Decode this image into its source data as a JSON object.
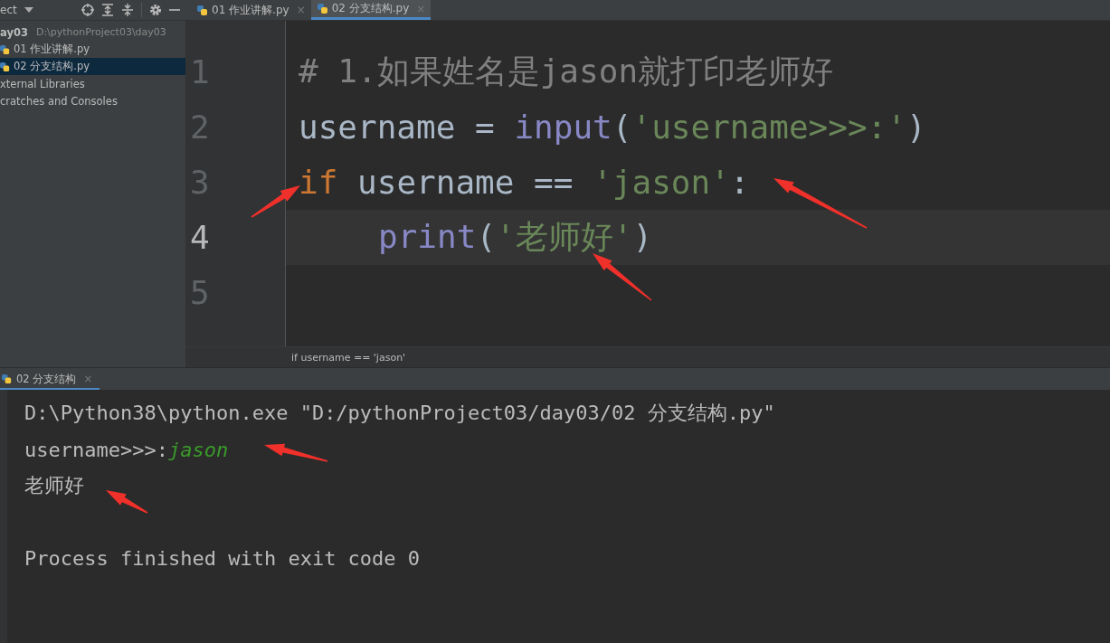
{
  "project_panel": {
    "title": "ect",
    "tree": [
      {
        "name": "ay03",
        "path": "D:\\pythonProject03\\day03",
        "children": [
          {
            "name": "01 作业讲解.py",
            "kind": "python",
            "selected": false
          },
          {
            "name": "02 分支结构.py",
            "kind": "python",
            "selected": true
          }
        ]
      },
      {
        "name": "xternal Libraries",
        "selected": false
      },
      {
        "name": "cratches and Consoles",
        "selected": false
      }
    ]
  },
  "tabs": [
    {
      "label": "01 作业讲解.py",
      "selected": false,
      "close": "×"
    },
    {
      "label": "02 分支结构.py",
      "selected": true,
      "close": "×"
    }
  ],
  "editor": {
    "lines": [
      {
        "number": "1",
        "current": false,
        "kind": "top",
        "tokens": [
          {
            "kind": "comment",
            "text": "# 1.如果姓名是jason就打印老师好"
          }
        ]
      },
      {
        "number": "2",
        "current": false,
        "kind": "top",
        "tokens": [
          {
            "kind": "ident",
            "text": "username = "
          },
          {
            "kind": "builtin",
            "text": "input"
          },
          {
            "kind": "ident",
            "text": "("
          },
          {
            "kind": "string",
            "text": "'username>>>:'"
          },
          {
            "kind": "ident",
            "text": ")"
          }
        ]
      },
      {
        "number": "3",
        "current": false,
        "kind": "top",
        "tokens": [
          {
            "kind": "keyword",
            "text": "if "
          },
          {
            "kind": "ident",
            "text": "username == "
          },
          {
            "kind": "string",
            "text": "'jason'"
          },
          {
            "kind": "ident",
            "text": ":"
          }
        ]
      },
      {
        "number": "4",
        "current": true,
        "kind": "body",
        "tokens": [
          {
            "kind": "builtin",
            "text": "print"
          },
          {
            "kind": "ident",
            "text": "("
          },
          {
            "kind": "string",
            "text": "'老师好'"
          },
          {
            "kind": "ident",
            "text": ")"
          }
        ]
      },
      {
        "number": "5",
        "current": false
      }
    ],
    "breadcrumb": "if username == 'jason'"
  },
  "run_panel": {
    "tab": {
      "label": "02 分支结构",
      "close": "×"
    },
    "lines": [
      {
        "tokens": [
          {
            "kind": "plain",
            "text": "D:\\Python38\\python.exe \"D:/pythonProject03/day03/02 分支结构.py\""
          }
        ]
      },
      {
        "tokens": [
          {
            "kind": "plain",
            "text": "username>>>:"
          },
          {
            "kind": "input",
            "text": "jason"
          }
        ]
      },
      {
        "tokens": [
          {
            "kind": "plain",
            "text": "老师好"
          }
        ]
      },
      {
        "tokens": [
          {
            "kind": "plain",
            "text": "Process finished with exit code 0"
          }
        ]
      }
    ]
  }
}
